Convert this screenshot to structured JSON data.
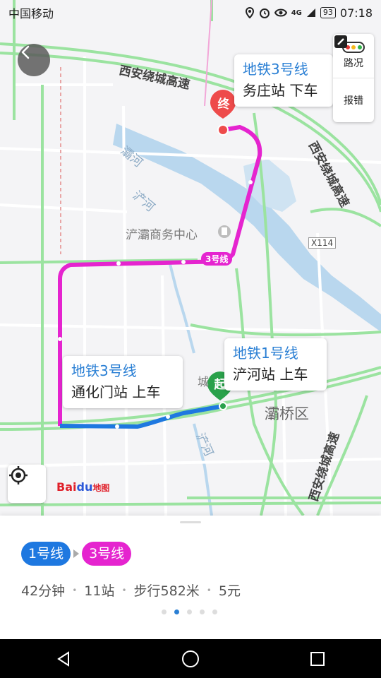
{
  "status_bar": {
    "carrier": "中国移动",
    "battery": "93",
    "time": "07:18",
    "signal_text": "4G"
  },
  "map_tools": {
    "traffic_label": "路况",
    "report_label": "报错"
  },
  "callouts": {
    "end": {
      "line": "地铁3号线",
      "stop": "务庄站 下车"
    },
    "start_1": {
      "line": "地铁1号线",
      "stop": "浐河站 上车"
    },
    "transfer_3": {
      "line": "地铁3号线",
      "stop": "通化门站 上车"
    }
  },
  "markers": {
    "end": "终",
    "start": "起"
  },
  "map_labels": {
    "expressway_top": "西安绕城高速",
    "expressway_right": "西安绕城高速",
    "expressway_bottom": "西安绕城高速",
    "river_ba": "灞河",
    "river_chan": "浐河",
    "river_chan_2": "浐河",
    "business_center": "浐灞商务中心",
    "district": "灞桥区",
    "line3_tag": "3号线",
    "road_x114": "X114",
    "city_label": "城",
    "baidu_logo": "Bai",
    "baidu_paw": "du",
    "baidu_ditu": "地图"
  },
  "route": {
    "line_chips": [
      "1号线",
      "3号线"
    ],
    "duration": "42分钟",
    "stations": "11站",
    "walk": "步行582米",
    "fare": "5元",
    "page_count": 5,
    "active_page": 1
  },
  "colors": {
    "line1": "#1e78e0",
    "line3": "#e524cf",
    "callout_line_text": "#2a7fd4",
    "end_marker": "#ee4b4b",
    "start_marker": "#2aa14b"
  }
}
